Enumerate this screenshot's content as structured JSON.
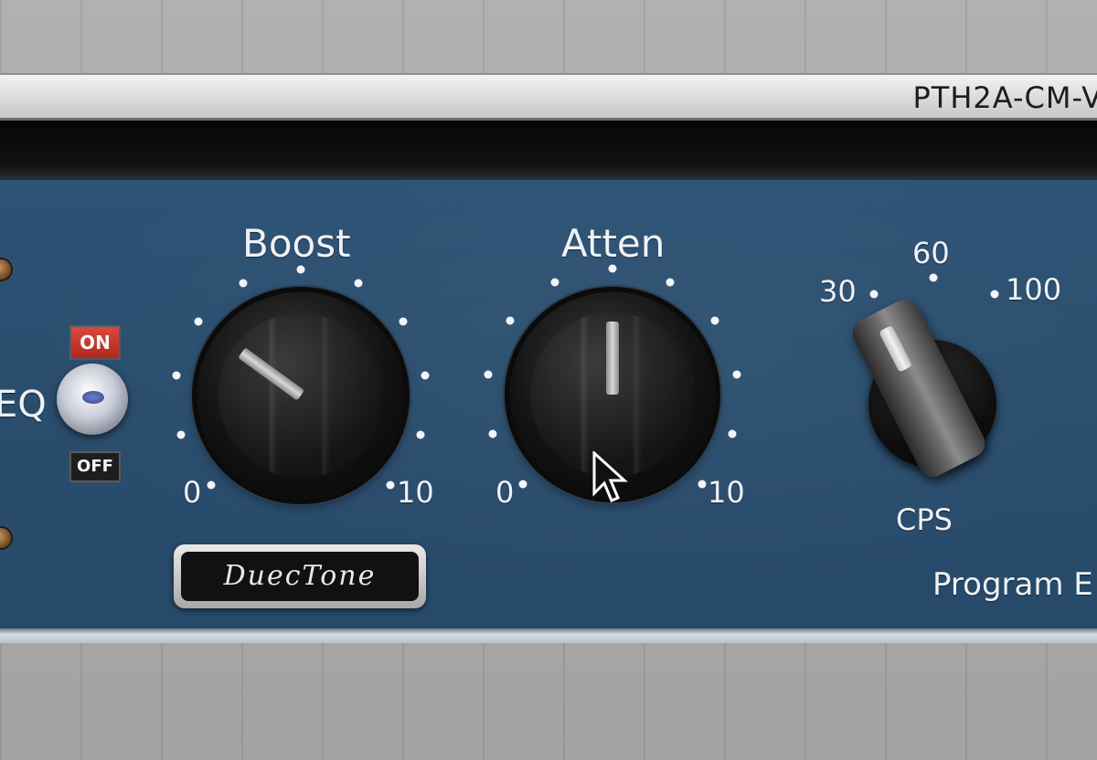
{
  "window": {
    "title": "PTH2A-CM-V"
  },
  "left_control": {
    "label": "EQ",
    "toggle_on": "ON",
    "toggle_off": "OFF"
  },
  "boost": {
    "label": "Boost",
    "min": "0",
    "max": "10",
    "value": 3
  },
  "atten": {
    "label": "Atten",
    "min": "0",
    "max": "10",
    "value": 5
  },
  "cps": {
    "label": "CPS",
    "options": [
      "30",
      "60",
      "100"
    ],
    "selected": "30"
  },
  "brand": {
    "name": "DuecTone"
  },
  "section": {
    "label": "Program E"
  },
  "colors": {
    "panel": "#2b4e6f",
    "title_bar": "#e6e6e6",
    "toggle_on": "#c7352b"
  }
}
